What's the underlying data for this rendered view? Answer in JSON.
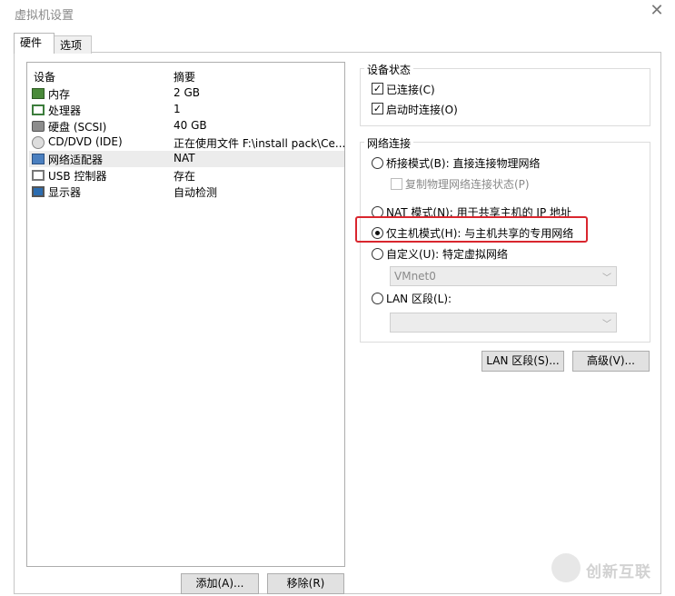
{
  "window": {
    "title": "虚拟机设置",
    "close_glyph": "✕"
  },
  "tabs": [
    {
      "label": "硬件"
    },
    {
      "label": "选项"
    }
  ],
  "device_list": {
    "header": {
      "device": "设备",
      "summary": "摘要"
    },
    "items": [
      {
        "name": "内存",
        "summary": "2 GB",
        "icon": "memory-icon"
      },
      {
        "name": "处理器",
        "summary": "1",
        "icon": "processor-icon"
      },
      {
        "name": "硬盘 (SCSI)",
        "summary": "40 GB",
        "icon": "hard-disk-icon"
      },
      {
        "name": "CD/DVD (IDE)",
        "summary": "正在使用文件 F:\\install pack\\Ce...",
        "icon": "cd-dvd-icon"
      },
      {
        "name": "网络适配器",
        "summary": "NAT",
        "icon": "network-adapter-icon"
      },
      {
        "name": "USB 控制器",
        "summary": "存在",
        "icon": "usb-controller-icon"
      },
      {
        "name": "显示器",
        "summary": "自动检测",
        "icon": "display-icon"
      }
    ]
  },
  "buttons": {
    "add": "添加(A)...",
    "remove": "移除(R)",
    "lan_segments": "LAN 区段(S)...",
    "advanced": "高级(V)..."
  },
  "device_status": {
    "title": "设备状态",
    "connected": {
      "label": "已连接(C)",
      "checked": true
    },
    "connect_at_power_on": {
      "label": "启动时连接(O)",
      "checked": true
    }
  },
  "network_connection": {
    "title": "网络连接",
    "options": {
      "bridged": "桥接模式(B): 直接连接物理网络",
      "replicate": "复制物理网络连接状态(P)",
      "nat": "NAT 模式(N): 用于共享主机的 IP 地址",
      "host_only": "仅主机模式(H): 与主机共享的专用网络",
      "custom": "自定义(U): 特定虚拟网络",
      "lan_segment": "LAN 区段(L):"
    },
    "selected": "host_only",
    "custom_network_value": "VMnet0",
    "lan_segment_value": ""
  },
  "watermark": {
    "text": "创新互联"
  },
  "colors": {
    "highlight": "#d9262e",
    "selected_row": "#ececec"
  }
}
